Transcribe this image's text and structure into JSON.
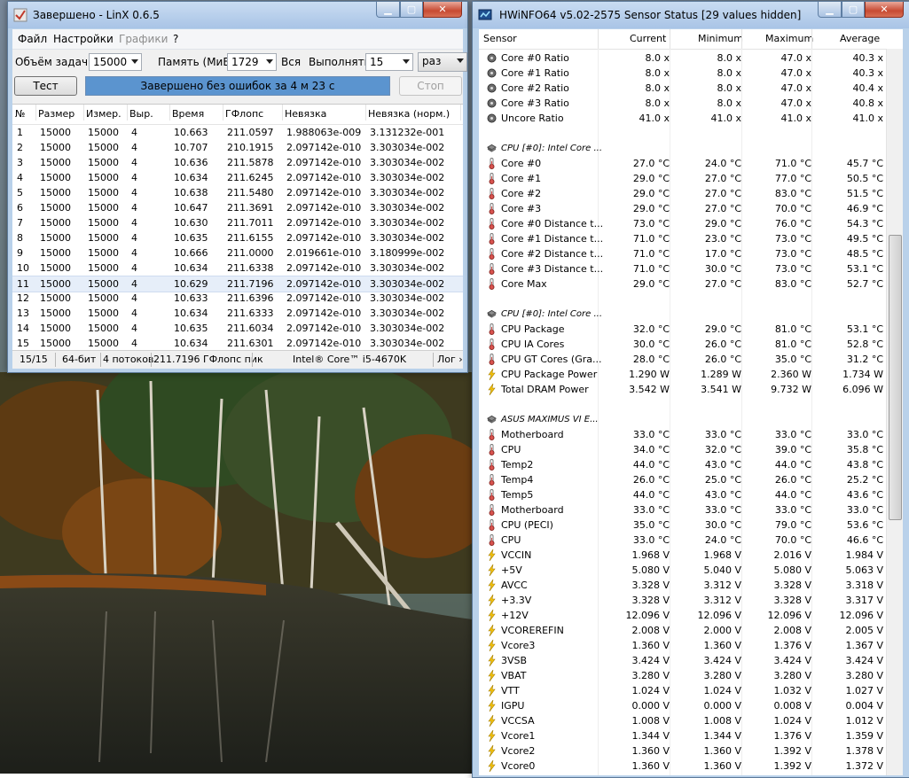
{
  "linx": {
    "title": "Завершено - LinX 0.6.5",
    "menu": [
      "Файл",
      "Настройки",
      "Графики",
      "?"
    ],
    "task_size_label": "Объём задачи:",
    "task_size_value": "15000",
    "memory_label": "Память (МиБ):",
    "memory_value": "1729",
    "all_label": "Вся",
    "run_label": "Выполнять:",
    "run_value": "15",
    "run_unit": "раз",
    "test_button": "Тест",
    "status_message": "Завершено без ошибок за 4 м 23 с",
    "stop_button": "Стоп",
    "columns": [
      "№",
      "Размер",
      "Измер.",
      "Выр.",
      "Время",
      "ГФлопс",
      "Невязка",
      "Невязка (норм.)"
    ],
    "rows": [
      [
        "1",
        "15000",
        "15000",
        "4",
        "10.663",
        "211.0597",
        "1.988063e-009",
        "3.131232e-001"
      ],
      [
        "2",
        "15000",
        "15000",
        "4",
        "10.707",
        "210.1915",
        "2.097142e-010",
        "3.303034e-002"
      ],
      [
        "3",
        "15000",
        "15000",
        "4",
        "10.636",
        "211.5878",
        "2.097142e-010",
        "3.303034e-002"
      ],
      [
        "4",
        "15000",
        "15000",
        "4",
        "10.634",
        "211.6245",
        "2.097142e-010",
        "3.303034e-002"
      ],
      [
        "5",
        "15000",
        "15000",
        "4",
        "10.638",
        "211.5480",
        "2.097142e-010",
        "3.303034e-002"
      ],
      [
        "6",
        "15000",
        "15000",
        "4",
        "10.647",
        "211.3691",
        "2.097142e-010",
        "3.303034e-002"
      ],
      [
        "7",
        "15000",
        "15000",
        "4",
        "10.630",
        "211.7011",
        "2.097142e-010",
        "3.303034e-002"
      ],
      [
        "8",
        "15000",
        "15000",
        "4",
        "10.635",
        "211.6155",
        "2.097142e-010",
        "3.303034e-002"
      ],
      [
        "9",
        "15000",
        "15000",
        "4",
        "10.666",
        "211.0000",
        "2.019661e-010",
        "3.180999e-002"
      ],
      [
        "10",
        "15000",
        "15000",
        "4",
        "10.634",
        "211.6338",
        "2.097142e-010",
        "3.303034e-002"
      ],
      [
        "11",
        "15000",
        "15000",
        "4",
        "10.629",
        "211.7196",
        "2.097142e-010",
        "3.303034e-002"
      ],
      [
        "12",
        "15000",
        "15000",
        "4",
        "10.633",
        "211.6396",
        "2.097142e-010",
        "3.303034e-002"
      ],
      [
        "13",
        "15000",
        "15000",
        "4",
        "10.634",
        "211.6333",
        "2.097142e-010",
        "3.303034e-002"
      ],
      [
        "14",
        "15000",
        "15000",
        "4",
        "10.635",
        "211.6034",
        "2.097142e-010",
        "3.303034e-002"
      ],
      [
        "15",
        "15000",
        "15000",
        "4",
        "10.634",
        "211.6301",
        "2.097142e-010",
        "3.303034e-002"
      ]
    ],
    "status": {
      "count": "15/15",
      "bits": "64-бит",
      "threads": "4 потоков",
      "peak": "211.7196 ГФлопс пик",
      "cpu": "Intel® Core™ i5-4670K",
      "log": "Лог ›"
    }
  },
  "hwinfo": {
    "title": "HWiNFO64 v5.02-2575 Sensor Status [29 values hidden]",
    "columns": [
      "Sensor",
      "Current",
      "Minimum",
      "Maximum",
      "Average"
    ],
    "rows": [
      {
        "icon": "ratio",
        "name": "Core #0 Ratio",
        "cur": "8.0 x",
        "min": "8.0 x",
        "max": "47.0 x",
        "avg": "40.3 x"
      },
      {
        "icon": "ratio",
        "name": "Core #1 Ratio",
        "cur": "8.0 x",
        "min": "8.0 x",
        "max": "47.0 x",
        "avg": "40.3 x"
      },
      {
        "icon": "ratio",
        "name": "Core #2 Ratio",
        "cur": "8.0 x",
        "min": "8.0 x",
        "max": "47.0 x",
        "avg": "40.4 x"
      },
      {
        "icon": "ratio",
        "name": "Core #3 Ratio",
        "cur": "8.0 x",
        "min": "8.0 x",
        "max": "47.0 x",
        "avg": "40.8 x"
      },
      {
        "icon": "ratio",
        "name": "Uncore Ratio",
        "cur": "41.0 x",
        "min": "41.0 x",
        "max": "41.0 x",
        "avg": "41.0 x"
      },
      {
        "icon": "blank"
      },
      {
        "icon": "chip",
        "group": "CPU [#0]: Intel Core ..."
      },
      {
        "icon": "temp",
        "name": "Core #0",
        "cur": "27.0 °C",
        "min": "24.0 °C",
        "max": "71.0 °C",
        "avg": "45.7 °C"
      },
      {
        "icon": "temp",
        "name": "Core #1",
        "cur": "29.0 °C",
        "min": "27.0 °C",
        "max": "77.0 °C",
        "avg": "50.5 °C"
      },
      {
        "icon": "temp",
        "name": "Core #2",
        "cur": "29.0 °C",
        "min": "27.0 °C",
        "max": "83.0 °C",
        "avg": "51.5 °C"
      },
      {
        "icon": "temp",
        "name": "Core #3",
        "cur": "29.0 °C",
        "min": "27.0 °C",
        "max": "70.0 °C",
        "avg": "46.9 °C"
      },
      {
        "icon": "temp",
        "name": "Core #0 Distance t...",
        "cur": "73.0 °C",
        "min": "29.0 °C",
        "max": "76.0 °C",
        "avg": "54.3 °C"
      },
      {
        "icon": "temp",
        "name": "Core #1 Distance t...",
        "cur": "71.0 °C",
        "min": "23.0 °C",
        "max": "73.0 °C",
        "avg": "49.5 °C"
      },
      {
        "icon": "temp",
        "name": "Core #2 Distance t...",
        "cur": "71.0 °C",
        "min": "17.0 °C",
        "max": "73.0 °C",
        "avg": "48.5 °C"
      },
      {
        "icon": "temp",
        "name": "Core #3 Distance t...",
        "cur": "71.0 °C",
        "min": "30.0 °C",
        "max": "73.0 °C",
        "avg": "53.1 °C"
      },
      {
        "icon": "temp",
        "name": "Core Max",
        "cur": "29.0 °C",
        "min": "27.0 °C",
        "max": "83.0 °C",
        "avg": "52.7 °C"
      },
      {
        "icon": "blank"
      },
      {
        "icon": "chip",
        "group": "CPU [#0]: Intel Core ..."
      },
      {
        "icon": "temp",
        "name": "CPU Package",
        "cur": "32.0 °C",
        "min": "29.0 °C",
        "max": "81.0 °C",
        "avg": "53.1 °C"
      },
      {
        "icon": "temp",
        "name": "CPU IA Cores",
        "cur": "30.0 °C",
        "min": "26.0 °C",
        "max": "81.0 °C",
        "avg": "52.8 °C"
      },
      {
        "icon": "temp",
        "name": "CPU GT Cores (Gra...",
        "cur": "28.0 °C",
        "min": "26.0 °C",
        "max": "35.0 °C",
        "avg": "31.2 °C"
      },
      {
        "icon": "bolt",
        "name": "CPU Package Power",
        "cur": "1.290 W",
        "min": "1.289 W",
        "max": "2.360 W",
        "avg": "1.734 W"
      },
      {
        "icon": "bolt",
        "name": "Total DRAM Power",
        "cur": "3.542 W",
        "min": "3.541 W",
        "max": "9.732 W",
        "avg": "6.096 W"
      },
      {
        "icon": "blank"
      },
      {
        "icon": "chip",
        "group": "ASUS MAXIMUS VI E..."
      },
      {
        "icon": "temp",
        "name": "Motherboard",
        "cur": "33.0 °C",
        "min": "33.0 °C",
        "max": "33.0 °C",
        "avg": "33.0 °C"
      },
      {
        "icon": "temp",
        "name": "CPU",
        "cur": "34.0 °C",
        "min": "32.0 °C",
        "max": "39.0 °C",
        "avg": "35.8 °C"
      },
      {
        "icon": "temp",
        "name": "Temp2",
        "cur": "44.0 °C",
        "min": "43.0 °C",
        "max": "44.0 °C",
        "avg": "43.8 °C"
      },
      {
        "icon": "temp",
        "name": "Temp4",
        "cur": "26.0 °C",
        "min": "25.0 °C",
        "max": "26.0 °C",
        "avg": "25.2 °C"
      },
      {
        "icon": "temp",
        "name": "Temp5",
        "cur": "44.0 °C",
        "min": "43.0 °C",
        "max": "44.0 °C",
        "avg": "43.6 °C"
      },
      {
        "icon": "temp",
        "name": "Motherboard",
        "cur": "33.0 °C",
        "min": "33.0 °C",
        "max": "33.0 °C",
        "avg": "33.0 °C"
      },
      {
        "icon": "temp",
        "name": "CPU (PECI)",
        "cur": "35.0 °C",
        "min": "30.0 °C",
        "max": "79.0 °C",
        "avg": "53.6 °C"
      },
      {
        "icon": "temp",
        "name": "CPU",
        "cur": "33.0 °C",
        "min": "24.0 °C",
        "max": "70.0 °C",
        "avg": "46.6 °C"
      },
      {
        "icon": "bolt",
        "name": "VCCIN",
        "cur": "1.968 V",
        "min": "1.968 V",
        "max": "2.016 V",
        "avg": "1.984 V"
      },
      {
        "icon": "bolt",
        "name": "+5V",
        "cur": "5.080 V",
        "min": "5.040 V",
        "max": "5.080 V",
        "avg": "5.063 V"
      },
      {
        "icon": "bolt",
        "name": "AVCC",
        "cur": "3.328 V",
        "min": "3.312 V",
        "max": "3.328 V",
        "avg": "3.318 V"
      },
      {
        "icon": "bolt",
        "name": "+3.3V",
        "cur": "3.328 V",
        "min": "3.312 V",
        "max": "3.328 V",
        "avg": "3.317 V"
      },
      {
        "icon": "bolt",
        "name": "+12V",
        "cur": "12.096 V",
        "min": "12.096 V",
        "max": "12.096 V",
        "avg": "12.096 V"
      },
      {
        "icon": "bolt",
        "name": "VCOREREFIN",
        "cur": "2.008 V",
        "min": "2.000 V",
        "max": "2.008 V",
        "avg": "2.005 V"
      },
      {
        "icon": "bolt",
        "name": "Vcore3",
        "cur": "1.360 V",
        "min": "1.360 V",
        "max": "1.376 V",
        "avg": "1.367 V"
      },
      {
        "icon": "bolt",
        "name": "3VSB",
        "cur": "3.424 V",
        "min": "3.424 V",
        "max": "3.424 V",
        "avg": "3.424 V"
      },
      {
        "icon": "bolt",
        "name": "VBAT",
        "cur": "3.280 V",
        "min": "3.280 V",
        "max": "3.280 V",
        "avg": "3.280 V"
      },
      {
        "icon": "bolt",
        "name": "VTT",
        "cur": "1.024 V",
        "min": "1.024 V",
        "max": "1.032 V",
        "avg": "1.027 V"
      },
      {
        "icon": "bolt",
        "name": "IGPU",
        "cur": "0.000 V",
        "min": "0.000 V",
        "max": "0.008 V",
        "avg": "0.004 V"
      },
      {
        "icon": "bolt",
        "name": "VCCSA",
        "cur": "1.008 V",
        "min": "1.008 V",
        "max": "1.024 V",
        "avg": "1.012 V"
      },
      {
        "icon": "bolt",
        "name": "Vcore1",
        "cur": "1.344 V",
        "min": "1.344 V",
        "max": "1.376 V",
        "avg": "1.359 V"
      },
      {
        "icon": "bolt",
        "name": "Vcore2",
        "cur": "1.360 V",
        "min": "1.360 V",
        "max": "1.392 V",
        "avg": "1.378 V"
      },
      {
        "icon": "bolt",
        "name": "Vcore0",
        "cur": "1.360 V",
        "min": "1.360 V",
        "max": "1.392 V",
        "avg": "1.372 V"
      }
    ]
  }
}
